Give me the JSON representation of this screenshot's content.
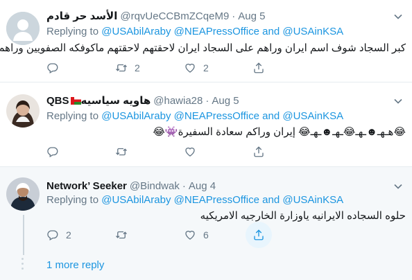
{
  "tweets": [
    {
      "name": "الأسد حر قادم",
      "handle": "@rqvUeCCBmZCqeM9",
      "dot": "·",
      "date": "Aug 5",
      "replying_prefix": "Replying to",
      "mention1": "@USAbilAraby",
      "mention2": "@NEAPressOffice",
      "and": "and",
      "mention3": "@USAinKSA",
      "text": "كبر السجاد شوف اسم ايران وراهم على السجاد ايران لاحقتهم لاحقتهم ماكوفكه الصفويين وراهم",
      "reply_count": "",
      "retweet_count": "2",
      "like_count": "2"
    },
    {
      "name": "QBS",
      "name_suffix": "هاويه سياسيه",
      "handle": "@hawia28",
      "dot": "·",
      "date": "Aug 5",
      "replying_prefix": "Replying to",
      "mention1": "@USAbilAraby",
      "mention2": "@NEAPressOffice",
      "and": "and",
      "mention3": "@USAinKSA",
      "text": "😂هـهـ☻ـهـ😂ـهـ☻ـهـ😂  إيران وراكم سعادة السفيرة👾😂",
      "reply_count": "",
      "retweet_count": "",
      "like_count": ""
    },
    {
      "name": "Network’ Seeker",
      "handle": "@Bindwak",
      "dot": "·",
      "date": "Aug 4",
      "replying_prefix": "Replying to",
      "mention1": "@USAbilAraby",
      "mention2": "@NEAPressOffice",
      "and": "and",
      "mention3": "@USAinKSA",
      "text": "حلوه السجاده الايرانيه ياوزارة الخارجيه الامريكيه",
      "reply_count": "2",
      "retweet_count": "",
      "like_count": "6"
    }
  ],
  "more_reply_label": "1 more reply",
  "colors": {
    "link": "#1b95e0",
    "muted": "#657786",
    "border": "#e6ecf0",
    "shaded_bg": "#f5f8fa",
    "share_hover": "#e8f5fd"
  },
  "icons": [
    "reply-icon",
    "retweet-icon",
    "like-icon",
    "share-icon",
    "caret-down-icon",
    "oman-flag-icon"
  ]
}
